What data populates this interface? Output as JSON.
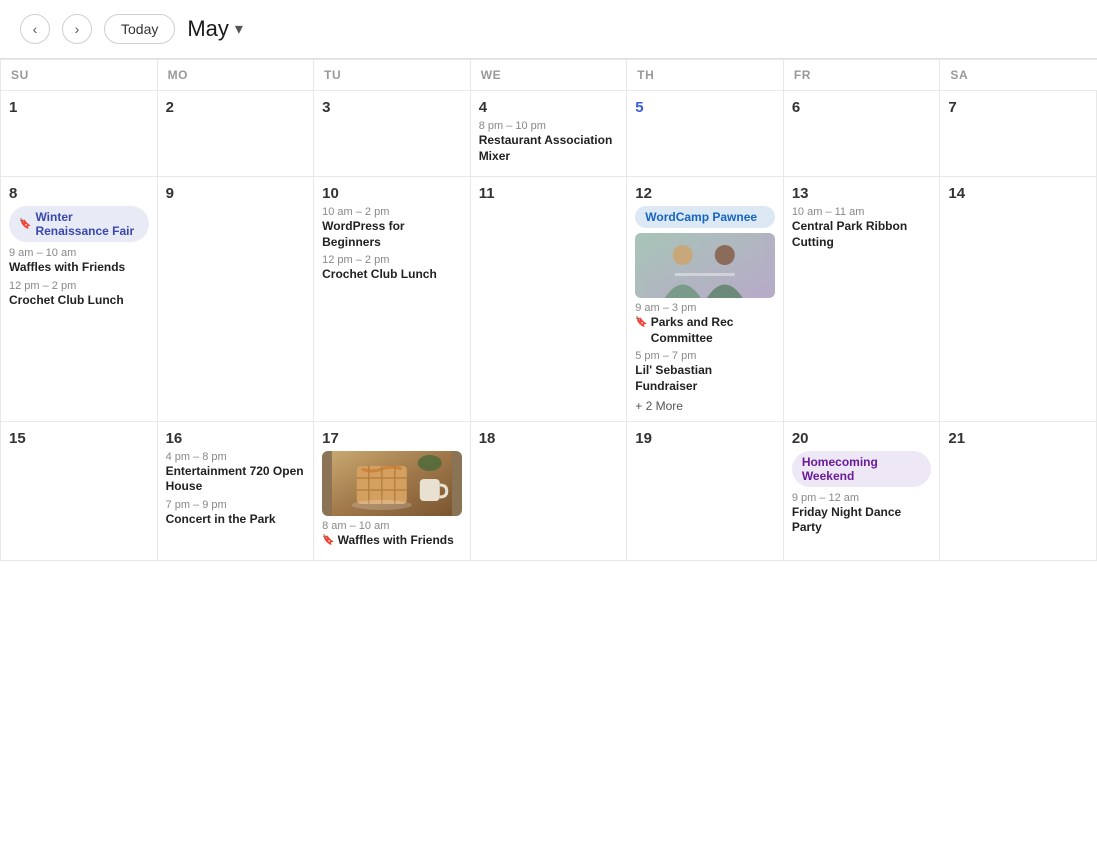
{
  "header": {
    "today_label": "Today",
    "month": "May",
    "chevron": "▾"
  },
  "days_of_week": [
    "SU",
    "MO",
    "TU",
    "WE",
    "TH",
    "FR",
    "SA"
  ],
  "rows": [
    {
      "cells": [
        {
          "day": "1",
          "muted": false,
          "today": false,
          "events": []
        },
        {
          "day": "2",
          "muted": false,
          "today": false,
          "events": []
        },
        {
          "day": "3",
          "muted": false,
          "today": false,
          "events": []
        },
        {
          "day": "4",
          "muted": false,
          "today": false,
          "events": [
            {
              "type": "timed",
              "time": "8 pm – 10 pm",
              "title": "Restaurant Association Mixer"
            }
          ]
        },
        {
          "day": "5",
          "muted": false,
          "today": true,
          "events": []
        },
        {
          "day": "6",
          "muted": false,
          "today": false,
          "events": []
        },
        {
          "day": "7",
          "muted": false,
          "today": false,
          "events": []
        }
      ]
    },
    {
      "cells": [
        {
          "day": "8",
          "muted": false,
          "today": false,
          "banner": {
            "text": "Winter Renaissance Fair",
            "color": "indigo",
            "flag": true
          },
          "events": [
            {
              "type": "timed",
              "time": "9 am – 10 am",
              "title": "Waffles with Friends"
            },
            {
              "type": "timed",
              "time": "12 pm – 2 pm",
              "title": "Crochet Club Lunch"
            }
          ]
        },
        {
          "day": "9",
          "muted": false,
          "today": false,
          "events": []
        },
        {
          "day": "10",
          "muted": false,
          "today": false,
          "events": [
            {
              "type": "timed",
              "time": "10 am – 2 pm",
              "title": "WordPress for Beginners"
            },
            {
              "type": "timed",
              "time": "12 pm – 2 pm",
              "title": "Crochet Club Lunch"
            }
          ]
        },
        {
          "day": "11",
          "muted": false,
          "today": false,
          "events": []
        },
        {
          "day": "12",
          "muted": false,
          "today": false,
          "banner": {
            "text": "WordCamp Pawnee",
            "color": "blue",
            "flag": false
          },
          "events": [
            {
              "type": "image",
              "image": "wordcamp"
            },
            {
              "type": "timed-flag",
              "time": "9 am – 3 pm",
              "title": "Parks and Rec Committee",
              "flag": true
            },
            {
              "type": "timed",
              "time": "5 pm – 7 pm",
              "title": "Lil' Sebastian Fundraiser"
            },
            {
              "type": "more",
              "count": "+ 2 More"
            }
          ]
        },
        {
          "day": "13",
          "muted": false,
          "today": false,
          "events": [
            {
              "type": "timed",
              "time": "10 am – 11 am",
              "title": "Central Park Ribbon Cutting"
            }
          ]
        },
        {
          "day": "14",
          "muted": false,
          "today": false,
          "events": []
        }
      ]
    },
    {
      "cells": [
        {
          "day": "15",
          "muted": false,
          "today": false,
          "events": []
        },
        {
          "day": "16",
          "muted": false,
          "today": false,
          "events": [
            {
              "type": "timed",
              "time": "4 pm – 8 pm",
              "title": "Entertainment 720 Open House"
            },
            {
              "type": "timed",
              "time": "7 pm – 9 pm",
              "title": "Concert in the Park"
            }
          ]
        },
        {
          "day": "17",
          "muted": false,
          "today": false,
          "events": [
            {
              "type": "image",
              "image": "waffles"
            },
            {
              "type": "timed-flag",
              "time": "8 am – 10 am",
              "title": "Waffles with Friends",
              "flag": true
            }
          ]
        },
        {
          "day": "18",
          "muted": false,
          "today": false,
          "events": []
        },
        {
          "day": "19",
          "muted": false,
          "today": false,
          "events": []
        },
        {
          "day": "20",
          "muted": false,
          "today": false,
          "banner": {
            "text": "Homecoming Weekend",
            "color": "purple",
            "flag": false
          },
          "events": [
            {
              "type": "timed",
              "time": "9 pm – 12 am",
              "title": "Friday Night Dance Party"
            }
          ]
        },
        {
          "day": "21",
          "muted": false,
          "today": false,
          "events": []
        }
      ]
    }
  ]
}
